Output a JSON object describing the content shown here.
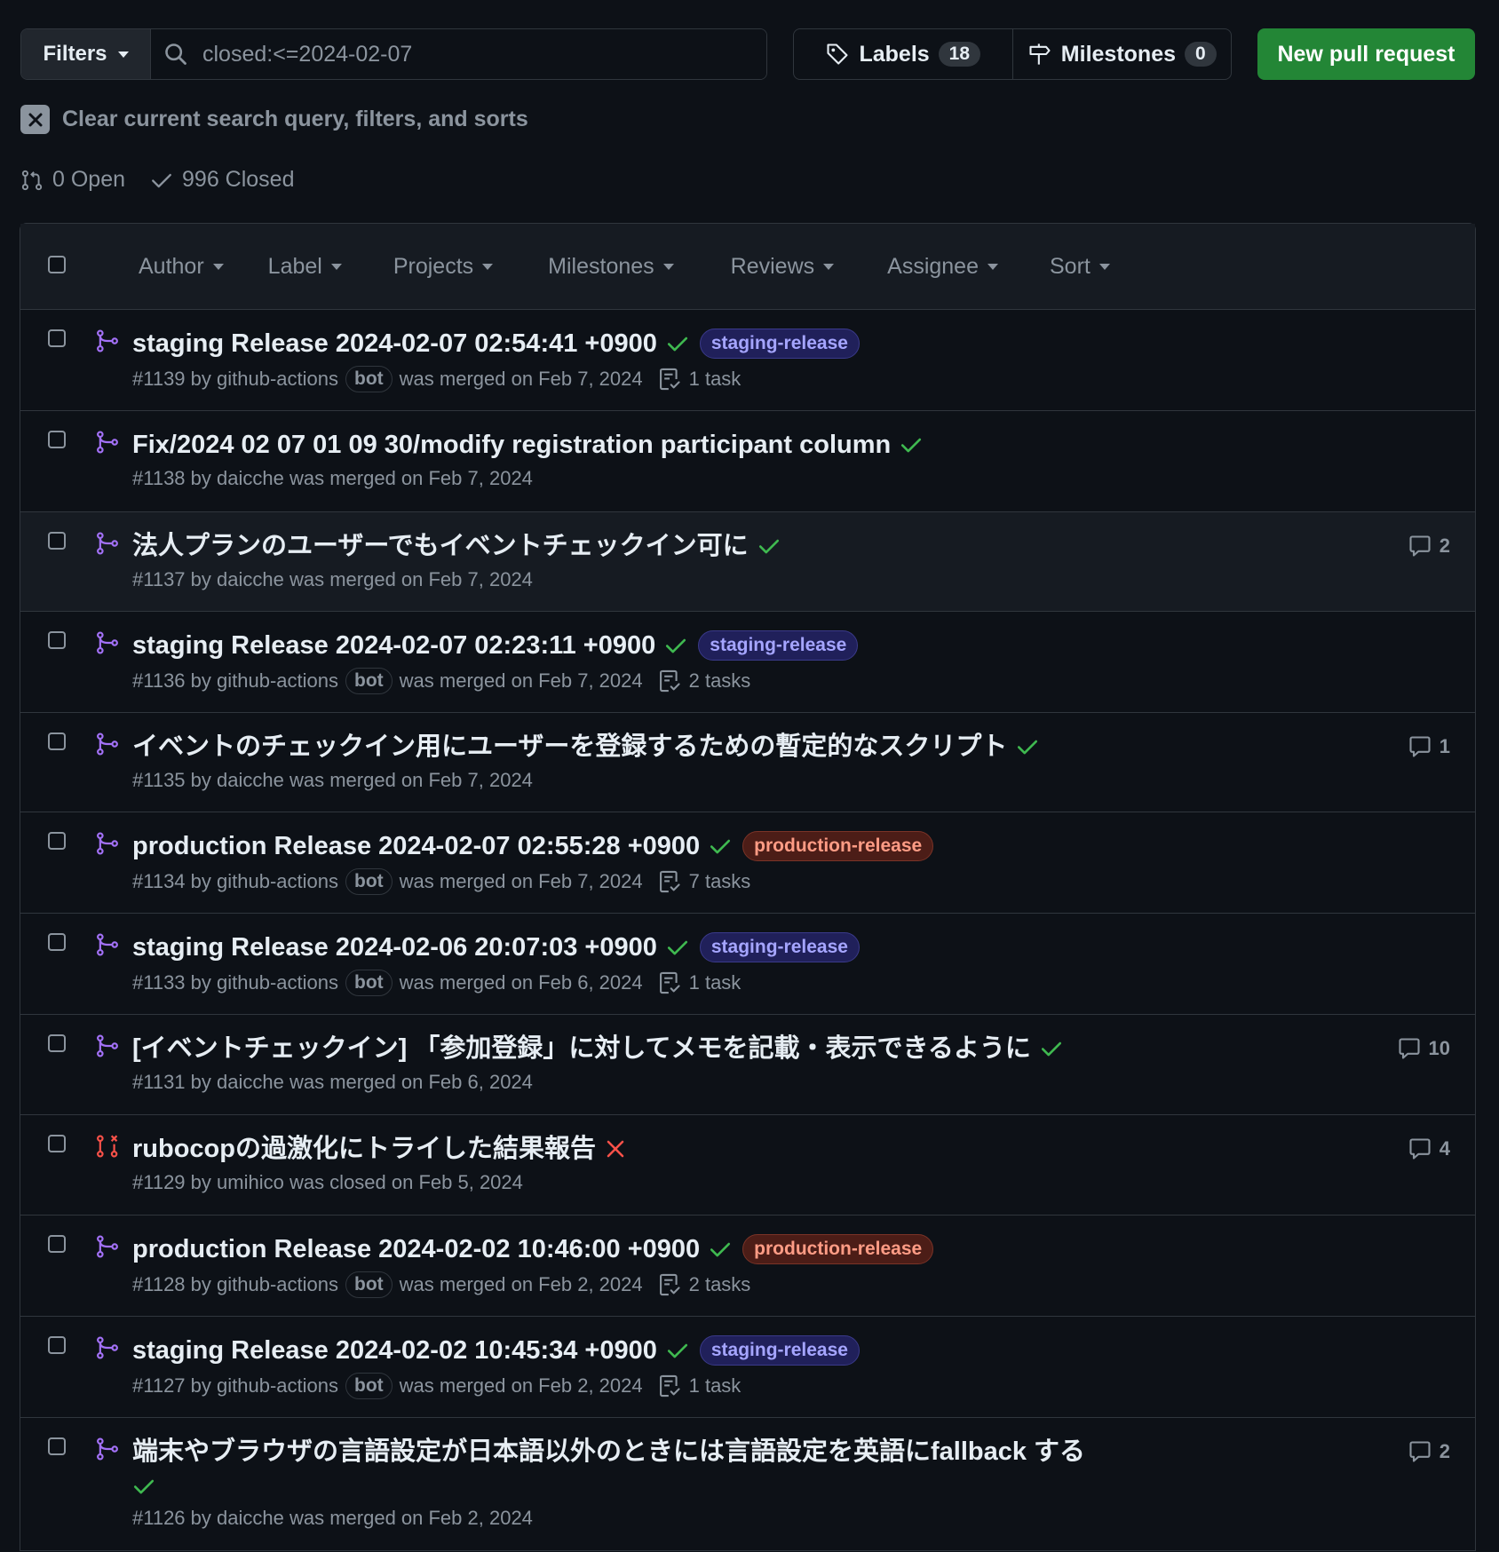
{
  "toolbar": {
    "filters_label": "Filters",
    "search_value": "closed:<=2024-02-07",
    "labels_label": "Labels",
    "labels_count": "18",
    "milestones_label": "Milestones",
    "milestones_count": "0",
    "new_pr_label": "New pull request"
  },
  "clear_query_label": "Clear current search query, filters, and sorts",
  "states": {
    "open": "0 Open",
    "closed": "996 Closed"
  },
  "list_header": {
    "author": "Author",
    "label": "Label",
    "projects": "Projects",
    "milestones": "Milestones",
    "reviews": "Reviews",
    "assignee": "Assignee",
    "sort": "Sort"
  },
  "colors": {
    "merged": "#a371f7",
    "closed": "#f85149",
    "check": "#3fb950",
    "accent_green": "#238636"
  },
  "rows": [
    {
      "title": "staging Release 2024-02-07 02:54:41 +0900",
      "status": "check",
      "label": "staging-release",
      "number": "#1139",
      "by": " by ",
      "author": "github-actions",
      "bot": "bot",
      "action": "was merged on Feb 7, 2024",
      "tasks": "1 task",
      "comments": ""
    },
    {
      "title": "Fix/2024 02 07 01 09 30/modify registration participant column",
      "status": "check",
      "label": "",
      "number": "#1138",
      "by": " by ",
      "author": "daicche",
      "bot": "",
      "action": " was merged on Feb 7, 2024",
      "tasks": "",
      "comments": ""
    },
    {
      "title": "法人プランのユーザーでもイベントチェックイン可に",
      "status": "check",
      "label": "",
      "number": "#1137",
      "by": " by ",
      "author": "daicche",
      "bot": "",
      "action": " was merged on Feb 7, 2024",
      "tasks": "",
      "comments": "2"
    },
    {
      "title": "staging Release 2024-02-07 02:23:11 +0900",
      "status": "check",
      "label": "staging-release",
      "number": "#1136",
      "by": " by ",
      "author": "github-actions",
      "bot": "bot",
      "action": "was merged on Feb 7, 2024",
      "tasks": "2 tasks",
      "comments": ""
    },
    {
      "title": "イベントのチェックイン用にユーザーを登録するための暫定的なスクリプト",
      "status": "check",
      "label": "",
      "number": "#1135",
      "by": " by ",
      "author": "daicche",
      "bot": "",
      "action": " was merged on Feb 7, 2024",
      "tasks": "",
      "comments": "1"
    },
    {
      "title": "production Release 2024-02-07 02:55:28 +0900",
      "status": "check",
      "label": "production-release",
      "number": "#1134",
      "by": " by ",
      "author": "github-actions",
      "bot": "bot",
      "action": "was merged on Feb 7, 2024",
      "tasks": "7 tasks",
      "comments": ""
    },
    {
      "title": "staging Release 2024-02-06 20:07:03 +0900",
      "status": "check",
      "label": "staging-release",
      "number": "#1133",
      "by": " by ",
      "author": "github-actions",
      "bot": "bot",
      "action": "was merged on Feb 6, 2024",
      "tasks": "1 task",
      "comments": ""
    },
    {
      "title": "[イベントチェックイン] 「参加登録」に対してメモを記載・表示できるように",
      "status": "check",
      "label": "",
      "number": "#1131",
      "by": " by ",
      "author": "daicche",
      "bot": "",
      "action": " was merged on Feb 6, 2024",
      "tasks": "",
      "comments": "10"
    },
    {
      "title": "rubocopの過激化にトライした結果報告",
      "status": "x",
      "label": "",
      "number": "#1129",
      "by": " by ",
      "author": "umihico",
      "bot": "",
      "action": " was closed on Feb 5, 2024",
      "tasks": "",
      "comments": "4"
    },
    {
      "title": "production Release 2024-02-02 10:46:00 +0900",
      "status": "check",
      "label": "production-release",
      "number": "#1128",
      "by": " by ",
      "author": "github-actions",
      "bot": "bot",
      "action": "was merged on Feb 2, 2024",
      "tasks": "2 tasks",
      "comments": ""
    },
    {
      "title": "staging Release 2024-02-02 10:45:34 +0900",
      "status": "check",
      "label": "staging-release",
      "number": "#1127",
      "by": " by ",
      "author": "github-actions",
      "bot": "bot",
      "action": "was merged on Feb 2, 2024",
      "tasks": "1 task",
      "comments": ""
    },
    {
      "title": "端末やブラウザの言語設定が日本語以外のときには言語設定を英語にfallback する",
      "status": "check",
      "label": "",
      "number": "#1126",
      "by": " by ",
      "author": "daicche",
      "bot": "",
      "action": " was merged on Feb 2, 2024",
      "tasks": "",
      "comments": "2"
    }
  ]
}
